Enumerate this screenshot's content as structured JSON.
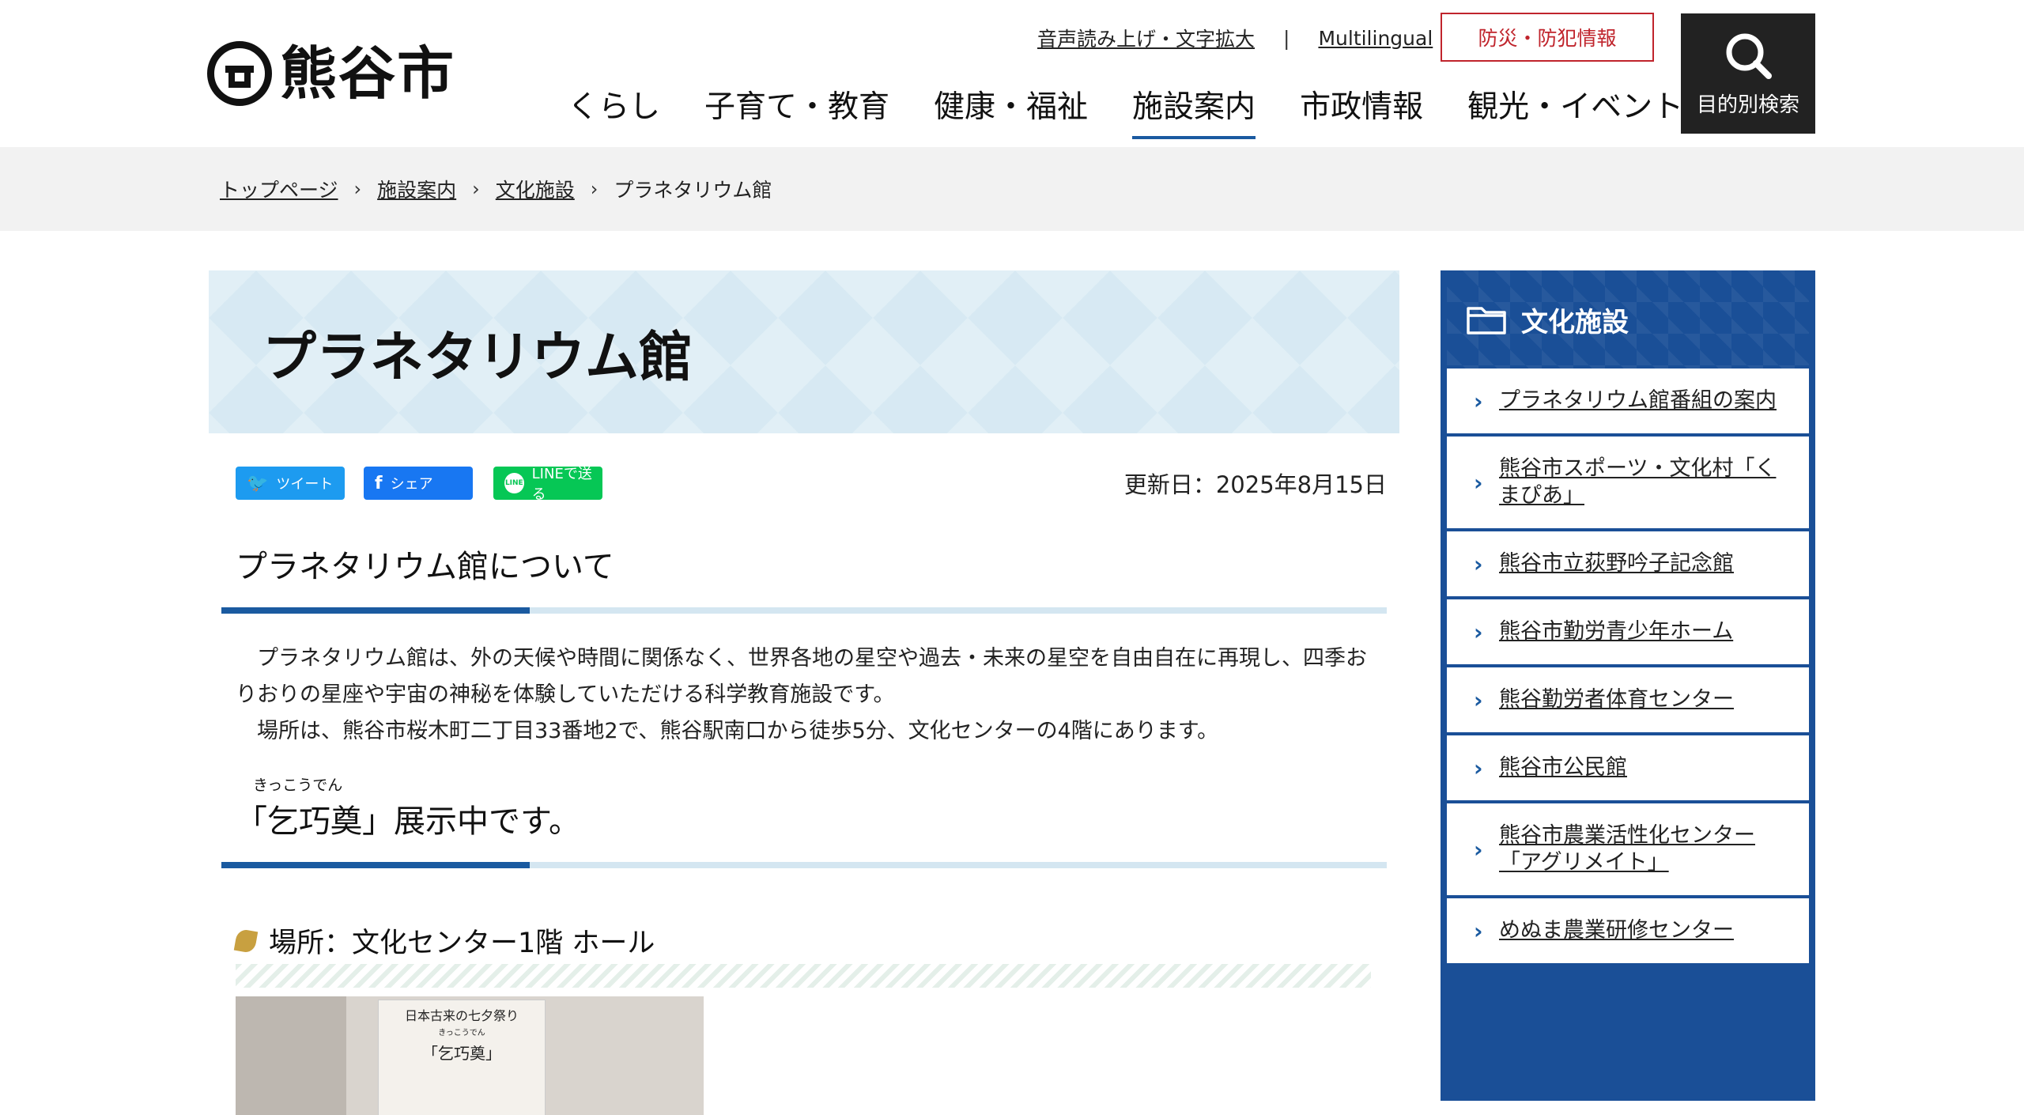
{
  "header": {
    "logo_text": "熊谷市",
    "util_links": [
      "音声読み上げ・文字拡大",
      "Multilingual"
    ],
    "util_sep": "|",
    "disaster_button": "防災・防犯情報",
    "search_label": "目的別検索",
    "nav": [
      "くらし",
      "子育て・教育",
      "健康・福祉",
      "施設案内",
      "市政情報",
      "観光・イベント"
    ],
    "active_nav": "施設案内"
  },
  "breadcrumb": [
    "トップページ",
    "施設案内",
    "文化施設",
    "プラネタリウム館"
  ],
  "page": {
    "title": "プラネタリウム館",
    "share": {
      "twitter": "ツイート",
      "facebook": "シェア",
      "line": "LINEで送る",
      "line_icon": "LINE"
    },
    "updated": "更新日：2025年8月15日",
    "section1_title": "プラネタリウム館について",
    "paragraphs": [
      "プラネタリウム館は、外の天候や時間に関係なく、世界各地の星空や過去・未来の星空を自由自在に再現し、四季おりおりの星座や宇宙の神秘を体験していただける科学教育施設です。",
      "場所は、熊谷市桜木町二丁目33番地2で、熊谷駅南口から徒歩5分、文化センターの4階にあります。"
    ],
    "section2_ruby": "きっこうでん",
    "section2_title": "「乞巧奠」展示中です。",
    "location": "場所：文化センター1階 ホール",
    "photo_poster_title": "日本古来の七夕祭り",
    "photo_poster_ruby": "きっこうでん",
    "photo_poster_name": "「乞巧奠」"
  },
  "sidebar": {
    "title": "文化施設",
    "items": [
      "プラネタリウム館番組の案内",
      "熊谷市スポーツ・文化村「くまぴあ」",
      "熊谷市立荻野吟子記念館",
      "熊谷市勤労青少年ホーム",
      "熊谷勤労者体育センター",
      "熊谷市公民館",
      "熊谷市農業活性化センター「アグリメイト」",
      "めぬま農業研修センター"
    ]
  },
  "colors": {
    "accent": "#1a5aa0",
    "sidebar": "#1a4f97",
    "disaster": "#c0242c"
  }
}
